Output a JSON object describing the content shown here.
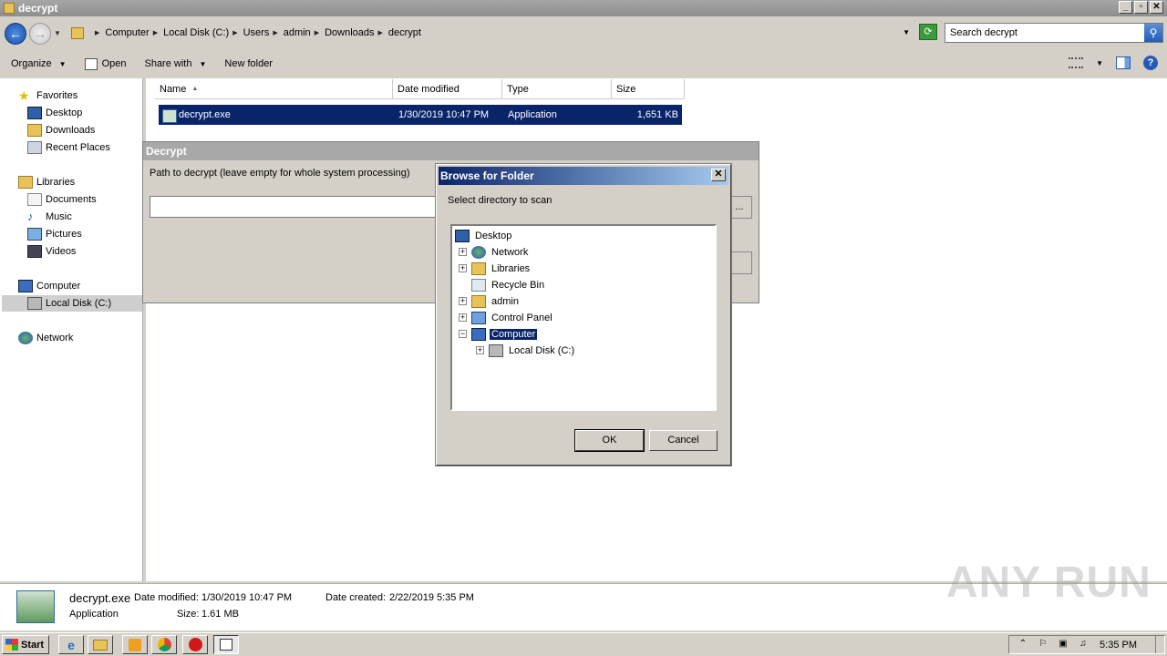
{
  "window": {
    "title": "decrypt"
  },
  "address": {
    "crumbs": [
      "Computer",
      "Local Disk (C:)",
      "Users",
      "admin",
      "Downloads",
      "decrypt"
    ],
    "search_placeholder": "Search decrypt"
  },
  "toolbar": {
    "organize": "Organize",
    "open": "Open",
    "share_with": "Share with",
    "new_folder": "New folder"
  },
  "nav": {
    "favorites": "Favorites",
    "desktop": "Desktop",
    "downloads": "Downloads",
    "recent_places": "Recent Places",
    "libraries": "Libraries",
    "documents": "Documents",
    "music": "Music",
    "pictures": "Pictures",
    "videos": "Videos",
    "computer": "Computer",
    "local_disk": "Local Disk (C:)",
    "network": "Network"
  },
  "columns": {
    "name": "Name",
    "date_modified": "Date modified",
    "type": "Type",
    "size": "Size"
  },
  "files": [
    {
      "name": "decrypt.exe",
      "date": "1/30/2019 10:47 PM",
      "type": "Application",
      "size": "1,651 KB"
    }
  ],
  "decrypt_window": {
    "title": "Decrypt",
    "label": "Path to decrypt (leave empty for whole system processing)",
    "browse": "..."
  },
  "browse_dialog": {
    "title": "Browse for Folder",
    "close": "✕",
    "prompt": "Select directory to scan",
    "tree": {
      "desktop": "Desktop",
      "network": "Network",
      "libraries": "Libraries",
      "recycle_bin": "Recycle Bin",
      "admin": "admin",
      "control_panel": "Control Panel",
      "computer": "Computer",
      "local_disk": "Local Disk (C:)"
    },
    "ok": "OK",
    "cancel": "Cancel"
  },
  "details": {
    "name": "decrypt.exe",
    "date_modified_label": "Date modified:",
    "date_modified": "1/30/2019 10:47 PM",
    "date_created_label": "Date created:",
    "date_created": "2/22/2019 5:35 PM",
    "type": "Application",
    "size_label": "Size:",
    "size": "1.61 MB"
  },
  "taskbar": {
    "start": "Start",
    "clock": "5:35 PM"
  },
  "watermark": "ANY RUN"
}
